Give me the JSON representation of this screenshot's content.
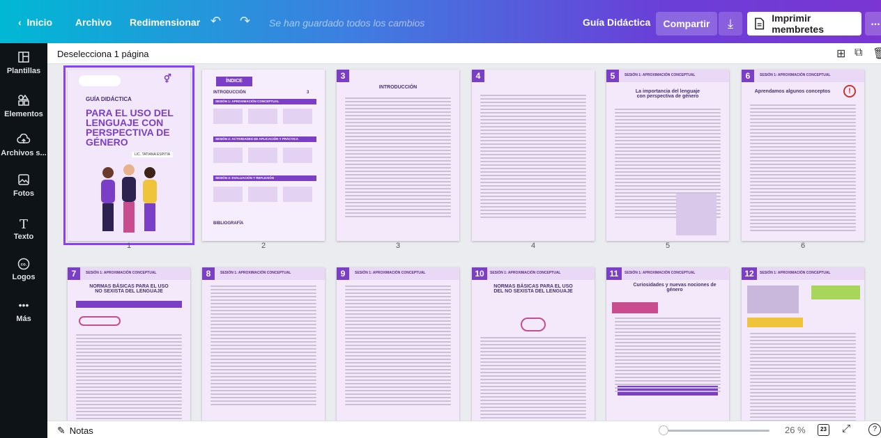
{
  "topbar": {
    "home": "Inicio",
    "file": "Archivo",
    "resize": "Redimensionar",
    "saved_status": "Se han guardado todos los cambios",
    "project_name": "Guía Didáctica",
    "share": "Compartir",
    "print": "Imprimir membretes",
    "more": "...",
    "colors": {
      "gradient_start": "#00b8d4",
      "gradient_end": "#7a35d2"
    }
  },
  "sidebar": {
    "items": [
      {
        "label": "Plantillas",
        "icon": "templates-icon"
      },
      {
        "label": "Elementos",
        "icon": "elements-icon"
      },
      {
        "label": "Archivos s...",
        "icon": "upload-cloud-icon"
      },
      {
        "label": "Fotos",
        "icon": "photos-icon"
      },
      {
        "label": "Texto",
        "icon": "text-icon"
      },
      {
        "label": "Logos",
        "icon": "logos-icon"
      },
      {
        "label": "Más",
        "icon": "more-dots-icon"
      }
    ]
  },
  "subheader": {
    "deselect": "Deselecciona 1 página"
  },
  "pages": [
    {
      "num": "1",
      "badge": "",
      "title": ""
    },
    {
      "num": "2",
      "badge": "",
      "title": ""
    },
    {
      "num": "3",
      "badge": "3",
      "title": "INTRODUCCIÓN"
    },
    {
      "num": "4",
      "badge": "4",
      "title": ""
    },
    {
      "num": "5",
      "badge": "5",
      "title": "La importancia del lenguaje con perspectiva de género"
    },
    {
      "num": "6",
      "badge": "6",
      "title": "Aprendamos algunos conceptos"
    },
    {
      "num": "7",
      "badge": "7",
      "title": "NORMAS BÁSICAS PARA EL USO NO SEXISTA DEL LENGUAJE"
    },
    {
      "num": "8",
      "badge": "8",
      "title": ""
    },
    {
      "num": "9",
      "badge": "9",
      "title": ""
    },
    {
      "num": "10",
      "badge": "10",
      "title": "NORMAS BÁSICAS PARA EL USO DEL NO SEXISTA DEL LENGUAJE"
    },
    {
      "num": "11",
      "badge": "11",
      "title": "Curiosidades y nuevas nociones de género"
    },
    {
      "num": "12",
      "badge": "12",
      "title": ""
    }
  ],
  "cover": {
    "subtitle": "GUÍA DIDÁCTICA",
    "title": "PARA EL USO DEL LENGUAJE CON PERSPECTIVA DE GÉNERO",
    "author": "LIC. TATIANA ESPITIA"
  },
  "index_page": {
    "header": "ÍNDICE",
    "intro": "INTRODUCCIÓN",
    "intro_page": "3",
    "session1": "SESIÓN 1: APROXIMACIÓN CONCEPTUAL",
    "session2": "SESIÓN 2: ACTIVIDADES DE APLICACIÓN Y PRÁCTICA",
    "session3": "SESIÓN 3: EVALUACIÓN Y REFLEXIÓN",
    "bibliography": "BIBLIOGRAFÍA"
  },
  "section_label": "SESIÓN 1: APROXIMACIÓN CONCEPTUAL",
  "notes": {
    "label": "Notas",
    "zoom": "26 %",
    "page_icon": "23",
    "help": "?"
  }
}
